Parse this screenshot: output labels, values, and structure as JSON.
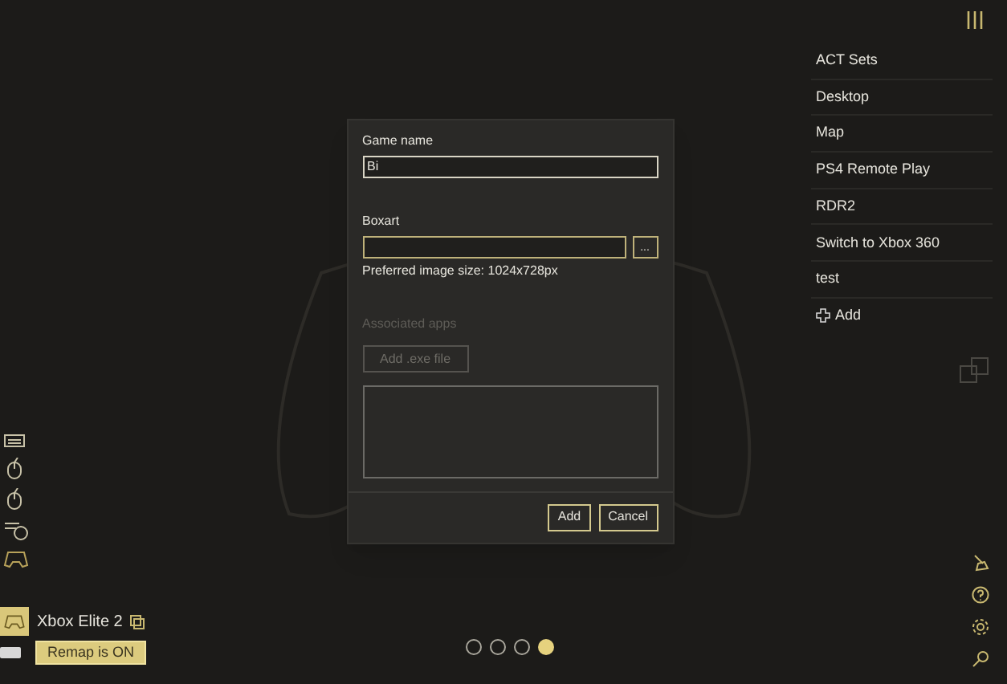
{
  "dialog": {
    "game_name": {
      "label": "Game name",
      "value": "Bi"
    },
    "boxart": {
      "label": "Boxart",
      "browse": "...",
      "hint": "Preferred image size: 1024x728px"
    },
    "associated_apps": {
      "label": "Associated apps",
      "disabled": true,
      "button": "Add .exe file"
    },
    "buttons": [
      "Add",
      "Cancel"
    ]
  },
  "sidebar": {
    "items": [
      "ACT Sets",
      "Desktop",
      "Map",
      "PS4 Remote Play",
      "RDR2",
      "Switch to Xbox 360",
      "test"
    ],
    "add": "Add"
  },
  "device": {
    "name": "Xbox Elite 2",
    "remap": "Remap is ON"
  },
  "pages": [
    {
      "selected": false
    },
    {
      "selected": false
    },
    {
      "selected": false
    },
    {
      "selected": true
    }
  ]
}
